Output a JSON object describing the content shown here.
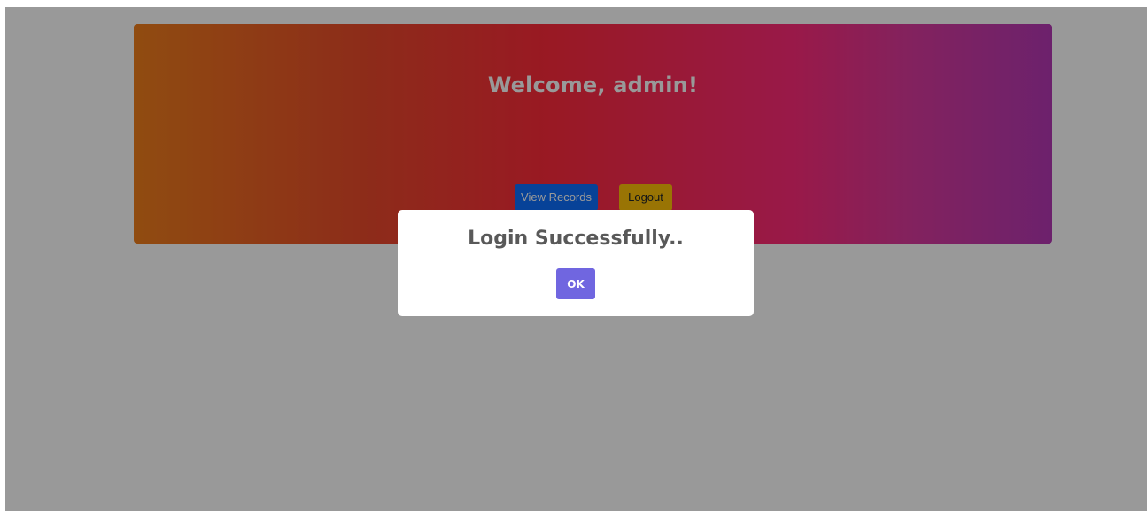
{
  "dashboard": {
    "title": "Welcome, admin!",
    "buttons": {
      "view_records": "View Records",
      "logout": "Logout"
    }
  },
  "modal": {
    "message": "Login Successfully..",
    "ok_label": "OK"
  },
  "colors": {
    "overlay": "#9a9a9a",
    "view_records_button": "#0d6efd",
    "logout_button": "#ffc107",
    "ok_button": "#7066e0",
    "modal_text": "#595959"
  }
}
